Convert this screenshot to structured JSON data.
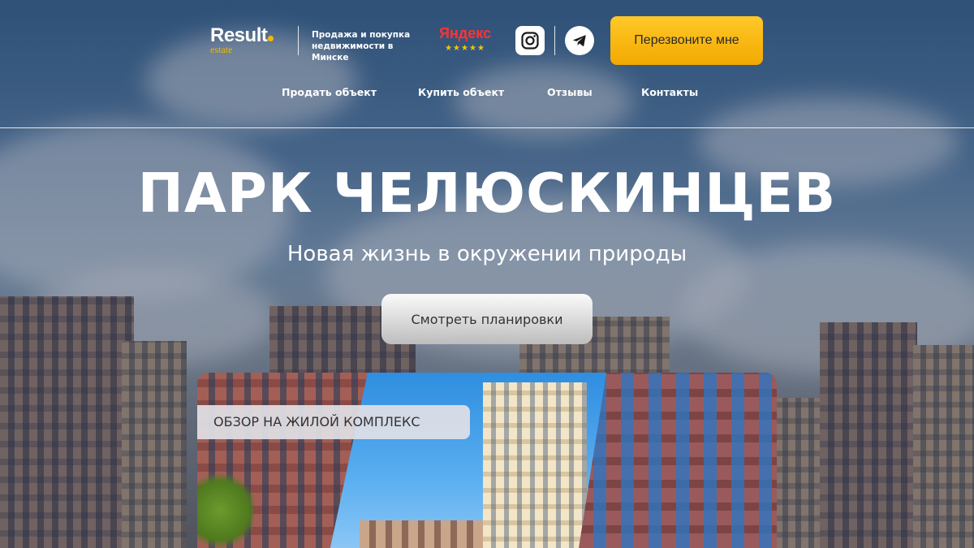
{
  "header": {
    "logo": {
      "word": "Result",
      "sub": "estate"
    },
    "tagline": "Продажа и покупка недвижимости в Минске",
    "yandex": {
      "name": "Яндекс",
      "stars": "★★★★★"
    },
    "callback_button": "Перезвоните мне"
  },
  "nav": {
    "items": [
      {
        "label": "Продать объект"
      },
      {
        "label": "Купить объект"
      },
      {
        "label": "Отзывы"
      },
      {
        "label": "Контакты"
      }
    ]
  },
  "hero": {
    "title": "ПАРК ЧЕЛЮСКИНЦЕВ",
    "subtitle": "Новая жизнь в окружении природы",
    "plans_button": "Смотреть планировки"
  },
  "video": {
    "badge": "ОБЗОР НА ЖИЛОЙ КОМПЛЕКС"
  },
  "colors": {
    "accent": "#f5b800",
    "button_yellow": "#f7b81a",
    "yandex_red": "#ff3333"
  },
  "icons": [
    "instagram-icon",
    "telegram-icon",
    "star-icon"
  ]
}
